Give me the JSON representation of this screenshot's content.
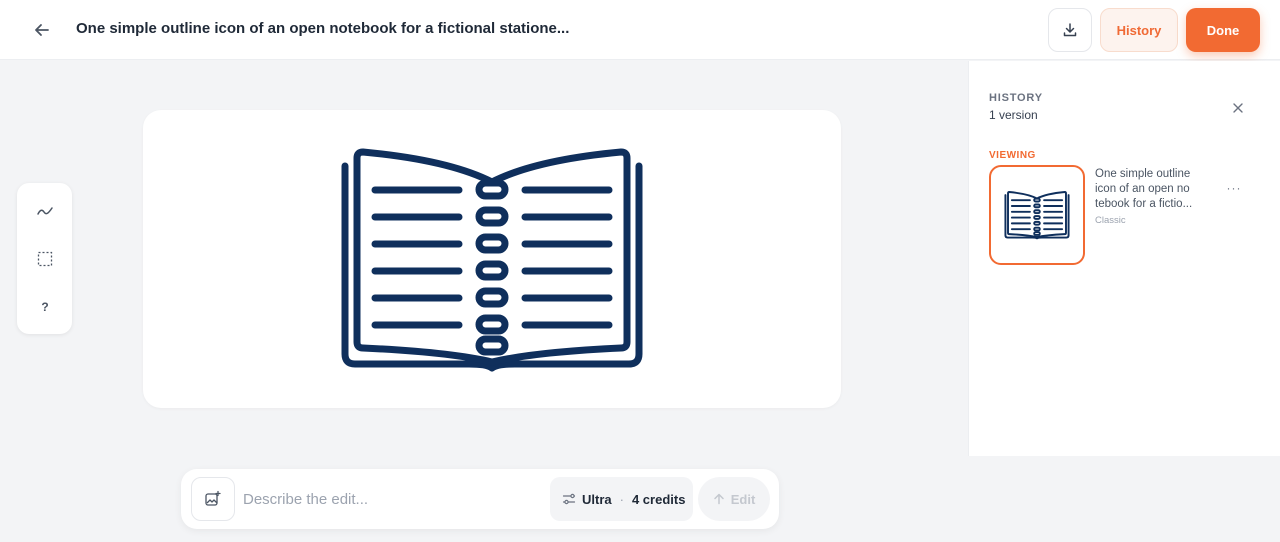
{
  "header": {
    "title": "One simple outline icon of an open notebook for a fictional statione...",
    "back_icon": "arrow-left-icon",
    "download_icon": "download-icon",
    "history_label": "History",
    "done_label": "Done"
  },
  "toolbar": {
    "tools": [
      {
        "name": "draw",
        "icon": "squiggle-icon"
      },
      {
        "name": "select",
        "icon": "dashed-square-icon"
      },
      {
        "name": "help",
        "icon": "question-icon",
        "glyph": "?"
      }
    ]
  },
  "canvas": {
    "image_subject": "open-notebook-outline-icon"
  },
  "prompt": {
    "placeholder": "Describe the edit...",
    "model": "Ultra",
    "credits": "4 credits",
    "edit_label": "Edit"
  },
  "history_panel": {
    "heading": "HISTORY",
    "count": "1 version",
    "viewing_label": "VIEWING",
    "versions": [
      {
        "title": "One simple outline icon of an open no tebook for a fictio...",
        "style": "Classic"
      }
    ]
  },
  "colors": {
    "accent": "#f26a32",
    "icon_navy": "#0f2f5c"
  }
}
